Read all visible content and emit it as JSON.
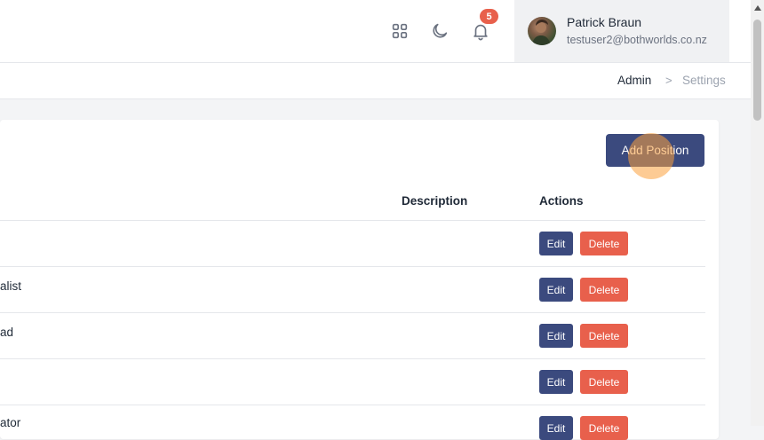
{
  "header": {
    "notification_count": "5",
    "icons": [
      "apps-grid-icon",
      "moon-icon",
      "bell-icon"
    ],
    "user": {
      "name": "Patrick Braun",
      "email": "testuser2@bothworlds.co.nz"
    }
  },
  "breadcrumb": {
    "items": [
      "Admin",
      "Settings"
    ],
    "separator": ">"
  },
  "positions": {
    "add_button_label": "Add Position",
    "columns": {
      "description": "Description",
      "actions": "Actions"
    },
    "rows": [
      {
        "name": ""
      },
      {
        "name": "alist"
      },
      {
        "name": "ad"
      },
      {
        "name": ""
      },
      {
        "name": "ator"
      }
    ],
    "edit_label": "Edit",
    "delete_label": "Delete"
  },
  "colors": {
    "primary": "#3b4a7e",
    "danger": "#e8604c",
    "badge": "#e8604c"
  }
}
